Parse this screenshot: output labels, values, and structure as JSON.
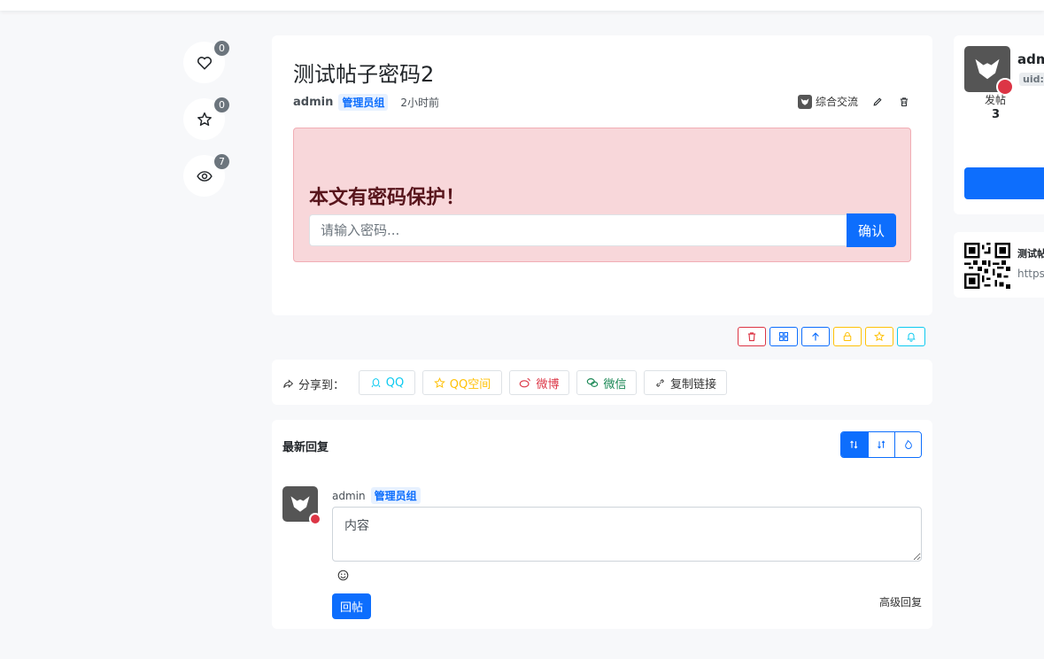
{
  "actions": {
    "like_count": "0",
    "fav_count": "0",
    "view_count": "7"
  },
  "post": {
    "title": "测试帖子密码2",
    "author": "admin",
    "group": "管理员组",
    "time": "2小时前",
    "forum": "综合交流",
    "password_prompt": "本文有密码保护！",
    "password_placeholder": "请输入密码...",
    "confirm_label": "确认"
  },
  "share": {
    "label": "分享到：",
    "qq": "QQ",
    "qzone": "QQ空间",
    "weibo": "微博",
    "wechat": "微信",
    "copy": "复制链接"
  },
  "reply": {
    "heading": "最新回复",
    "author": "admin",
    "group": "管理员组",
    "placeholder": "内容",
    "submit_label": "回帖",
    "advanced_label": "高级回复"
  },
  "user_card": {
    "name_partial": "adm",
    "uid_partial": "uid:",
    "posts_label": "发帖",
    "posts_value": "3"
  },
  "qr_card": {
    "title_partial": "测试帖",
    "url_partial": "https"
  },
  "colors": {
    "primary": "#0d6efd",
    "danger": "#dc3545",
    "warning": "#ffc107",
    "info": "#0dcaf0",
    "success": "#198754",
    "alert_bg": "#f8d7da"
  }
}
